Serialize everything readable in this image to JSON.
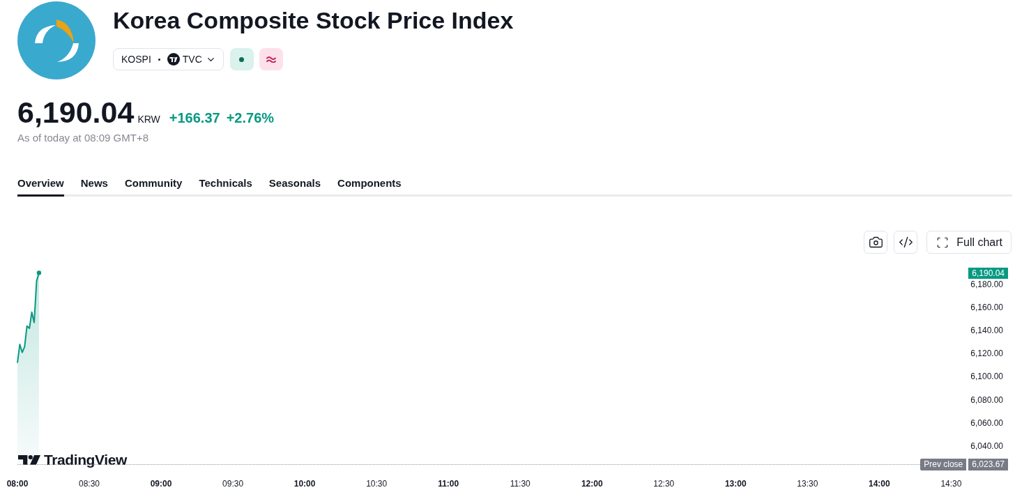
{
  "header": {
    "title": "Korea Composite Stock Price Index",
    "symbol": {
      "ticker": "KOSPI",
      "exchange": "TVC"
    },
    "badges": [
      {
        "kind": "market_open"
      },
      {
        "kind": "delayed"
      }
    ]
  },
  "quote": {
    "price": "6,190.04",
    "currency": "KRW",
    "change": "+166.37",
    "change_percent": "+2.76%",
    "as_of": "As of today at 08:09 GMT+8"
  },
  "tabs": [
    {
      "label": "Overview",
      "selected": true
    },
    {
      "label": "News",
      "selected": false
    },
    {
      "label": "Community",
      "selected": false
    },
    {
      "label": "Technicals",
      "selected": false
    },
    {
      "label": "Seasonals",
      "selected": false
    },
    {
      "label": "Components",
      "selected": false
    }
  ],
  "chart_toolbar": [
    {
      "kind": "snapshot"
    },
    {
      "kind": "embed"
    },
    {
      "kind": "full_chart",
      "label": "Full chart"
    }
  ],
  "chart": {
    "brand": "TradingView",
    "chart_data": {
      "type": "area",
      "categories": [
        "08:00",
        null,
        null,
        null,
        null,
        null,
        null,
        null,
        null,
        null,
        null,
        null,
        null,
        null,
        null,
        null,
        null,
        null,
        null,
        null,
        null,
        null,
        null,
        null,
        null,
        null,
        null,
        null,
        null,
        null,
        "08:30",
        null,
        null,
        null,
        null,
        null,
        null,
        null,
        null,
        null,
        null,
        null,
        null,
        null,
        null,
        null,
        null,
        null,
        null,
        null,
        null,
        null,
        null,
        null,
        null,
        null,
        null,
        null,
        null,
        null,
        "09:00",
        null,
        null,
        null,
        null,
        null,
        null,
        null,
        null,
        null,
        null,
        null,
        null,
        null,
        null,
        null,
        null,
        null,
        null,
        null,
        null,
        null,
        null,
        null,
        null,
        null,
        null,
        null,
        null,
        null,
        "09:30",
        null,
        null,
        null,
        null,
        null,
        null,
        null,
        null,
        null,
        null,
        null,
        null,
        null,
        null,
        null,
        null,
        null,
        null,
        null,
        null,
        null,
        null,
        null,
        null,
        null,
        null,
        null,
        null,
        null,
        "10:00",
        null,
        null,
        null,
        null,
        null,
        null,
        null,
        null,
        null,
        null,
        null,
        null,
        null,
        null,
        null,
        null,
        null,
        null,
        null,
        null,
        null,
        null,
        null,
        null,
        null,
        null,
        null,
        null,
        null,
        "10:30",
        null,
        null,
        null,
        null,
        null,
        null,
        null,
        null,
        null,
        null,
        null,
        null,
        null,
        null,
        null,
        null,
        null,
        null,
        null,
        null,
        null,
        null,
        null,
        null,
        null,
        null,
        null,
        null,
        null,
        "11:00",
        null,
        null,
        null,
        null,
        null,
        null,
        null,
        null,
        null,
        null,
        null,
        null,
        null,
        null,
        null,
        null,
        null,
        null,
        null,
        null,
        null,
        null,
        null,
        null,
        null,
        null,
        null,
        null,
        null,
        "11:30",
        null,
        null,
        null,
        null,
        null,
        null,
        null,
        null,
        null,
        null,
        null,
        null,
        null,
        null,
        null,
        null,
        null,
        null,
        null,
        null,
        null,
        null,
        null,
        null,
        null,
        null,
        null,
        null,
        null,
        "12:00",
        null,
        null,
        null,
        null,
        null,
        null,
        null,
        null,
        null,
        null,
        null,
        null,
        null,
        null,
        null,
        null,
        null,
        null,
        null,
        null,
        null,
        null,
        null,
        null,
        null,
        null,
        null,
        null,
        null,
        "12:30",
        null,
        null,
        null,
        null,
        null,
        null,
        null,
        null,
        null,
        null,
        null,
        null,
        null,
        null,
        null,
        null,
        null,
        null,
        null,
        null,
        null,
        null,
        null,
        null,
        null,
        null,
        null,
        null,
        null,
        "13:00",
        null,
        null,
        null,
        null,
        null,
        null,
        null,
        null,
        null,
        null,
        null,
        null,
        null,
        null,
        null,
        null,
        null,
        null,
        null,
        null,
        null,
        null,
        null,
        null,
        null,
        null,
        null,
        null,
        null,
        "13:30",
        null,
        null,
        null,
        null,
        null,
        null,
        null,
        null,
        null,
        null,
        null,
        null,
        null,
        null,
        null,
        null,
        null,
        null,
        null,
        null,
        null,
        null,
        null,
        null,
        null,
        null,
        null,
        null,
        null,
        "14:00",
        null,
        null,
        null,
        null,
        null,
        null,
        null,
        null,
        null,
        null,
        null,
        null,
        null,
        null,
        null,
        null,
        null,
        null,
        null,
        null,
        null,
        null,
        null,
        null,
        null,
        null,
        null,
        null,
        null,
        "14:30",
        null,
        null,
        null,
        null,
        null,
        null
      ],
      "series": [
        {
          "color": "#089981",
          "values": [
            6112,
            6128,
            6121,
            6126,
            6144,
            6142,
            6156,
            6147,
            6183,
            6190.04,
            null,
            null,
            null,
            null,
            null,
            null,
            null,
            null,
            null,
            null,
            null,
            null,
            null,
            null,
            null,
            null,
            null,
            null,
            null,
            null,
            null,
            null,
            null,
            null,
            null,
            null,
            null,
            null,
            null,
            null,
            null,
            null,
            null,
            null,
            null,
            null,
            null,
            null,
            null,
            null,
            null,
            null,
            null,
            null,
            null,
            null,
            null,
            null,
            null,
            null,
            null,
            null,
            null,
            null,
            null,
            null,
            null,
            null,
            null,
            null,
            null,
            null,
            null,
            null,
            null,
            null,
            null,
            null,
            null,
            null,
            null,
            null,
            null,
            null,
            null,
            null,
            null,
            null,
            null,
            null,
            null,
            null,
            null,
            null,
            null,
            null,
            null,
            null,
            null,
            null,
            null,
            null,
            null,
            null,
            null,
            null,
            null,
            null,
            null,
            null,
            null,
            null,
            null,
            null,
            null,
            null,
            null,
            null,
            null,
            null,
            null,
            null,
            null,
            null,
            null,
            null,
            null,
            null,
            null,
            null,
            null,
            null,
            null,
            null,
            null,
            null,
            null,
            null,
            null,
            null,
            null,
            null,
            null,
            null,
            null,
            null,
            null,
            null,
            null,
            null,
            null,
            null,
            null,
            null,
            null,
            null,
            null,
            null,
            null,
            null,
            null,
            null,
            null,
            null,
            null,
            null,
            null,
            null,
            null,
            null,
            null,
            null,
            null,
            null,
            null,
            null,
            null,
            null,
            null,
            null,
            null,
            null,
            null,
            null,
            null,
            null,
            null,
            null,
            null,
            null,
            null,
            null,
            null,
            null,
            null,
            null,
            null,
            null,
            null,
            null,
            null,
            null,
            null,
            null,
            null,
            null,
            null,
            null,
            null,
            null,
            null,
            null,
            null,
            null,
            null,
            null,
            null,
            null,
            null,
            null,
            null,
            null,
            null,
            null,
            null,
            null,
            null,
            null,
            null,
            null,
            null,
            null,
            null,
            null,
            null,
            null,
            null,
            null,
            null,
            null,
            null,
            null,
            null,
            null,
            null,
            null,
            null,
            null,
            null,
            null,
            null,
            null,
            null,
            null,
            null,
            null,
            null,
            null,
            null,
            null,
            null,
            null,
            null,
            null,
            null,
            null,
            null,
            null,
            null,
            null,
            null,
            null,
            null,
            null,
            null,
            null,
            null,
            null,
            null,
            null,
            null,
            null,
            null,
            null,
            null,
            null,
            null,
            null,
            null,
            null,
            null,
            null,
            null,
            null,
            null,
            null,
            null,
            null,
            null,
            null,
            null,
            null,
            null,
            null,
            null,
            null,
            null,
            null,
            null,
            null,
            null,
            null,
            null,
            null,
            null,
            null,
            null,
            null,
            null,
            null,
            null,
            null,
            null,
            null,
            null,
            null,
            null,
            null,
            null,
            null,
            null,
            null,
            null,
            null,
            null,
            null,
            null,
            null,
            null,
            null,
            null,
            null,
            null,
            null,
            null,
            null,
            null,
            null,
            null,
            null,
            null,
            null,
            null,
            null,
            null,
            null,
            null,
            null,
            null,
            null,
            null,
            null,
            null,
            null,
            null,
            null,
            null,
            null,
            null,
            null,
            null,
            null,
            null,
            null,
            null,
            null,
            null,
            null,
            null,
            null,
            null,
            null,
            null,
            null,
            null,
            null,
            null,
            null,
            null,
            null,
            null,
            null,
            null,
            null,
            null,
            null,
            null
          ]
        }
      ],
      "ylim": [
        6023.67,
        6190.04
      ],
      "yticks": [
        {
          "value": 6190.04,
          "label": "6,190.04"
        },
        {
          "value": 6180,
          "label": "6,180.00"
        },
        {
          "value": 6160,
          "label": "6,160.00"
        },
        {
          "value": 6140,
          "label": "6,140.00"
        },
        {
          "value": 6120,
          "label": "6,120.00"
        },
        {
          "value": 6100,
          "label": "6,100.00"
        },
        {
          "value": 6080,
          "label": "6,080.00"
        },
        {
          "value": 6060,
          "label": "6,060.00"
        },
        {
          "value": 6040,
          "label": "6,040.00"
        },
        {
          "value": 6023.67,
          "label": "6,023.67"
        }
      ],
      "ref_lines": [
        {
          "axis": "y",
          "value": 6023.67,
          "label": "Prev close"
        }
      ]
    }
  }
}
